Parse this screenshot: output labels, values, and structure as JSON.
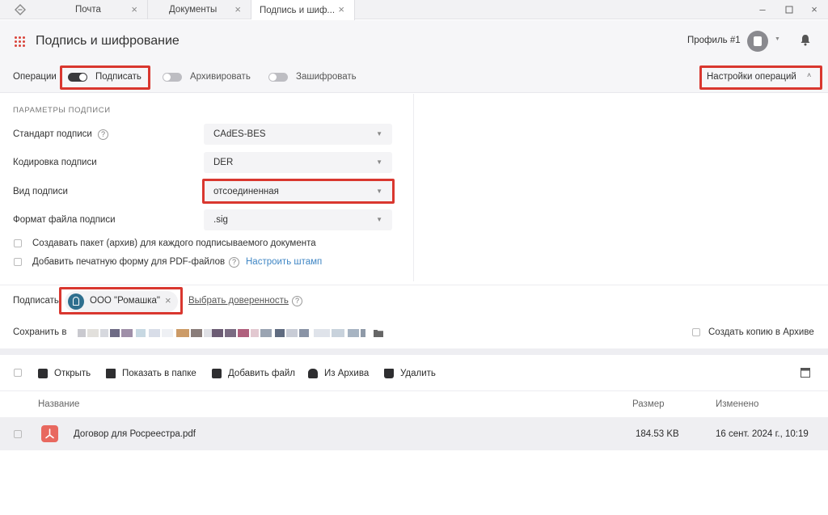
{
  "tabs": [
    {
      "label": "Почта"
    },
    {
      "label": "Документы"
    },
    {
      "label": "Подпись и шиф..."
    }
  ],
  "header": {
    "title": "Подпись и шифрование",
    "profile": "Профиль #1"
  },
  "ops": {
    "label": "Операции",
    "sign": "Подписать",
    "archive": "Архивировать",
    "encrypt": "Зашифровать",
    "settings": "Настройки операций"
  },
  "params": {
    "section_title": "ПАРАМЕТРЫ ПОДПИСИ",
    "standard_label": "Стандарт подписи",
    "standard_value": "CAdES-BES",
    "encoding_label": "Кодировка подписи",
    "encoding_value": "DER",
    "type_label": "Вид подписи",
    "type_value": "отсоединенная",
    "format_label": "Формат файла подписи",
    "format_value": ".sig",
    "pack_checkbox": "Создавать пакет (архив) для каждого подписываемого документа",
    "pdf_checkbox": "Добавить печатную форму для PDF-файлов",
    "stamp_link": "Настроить штамп"
  },
  "signer": {
    "label": "Подписать",
    "chip": "ООО \"Ромашка\"",
    "power_link": "Выбрать доверенность"
  },
  "save": {
    "label": "Сохранить в",
    "copy_checkbox": "Создать копию в Архиве"
  },
  "toolbar": {
    "open": "Открыть",
    "show_folder": "Показать в папке",
    "add_file": "Добавить файл",
    "from_archive": "Из Архива",
    "delete": "Удалить"
  },
  "table": {
    "columns": [
      "Название",
      "Размер",
      "Изменено"
    ],
    "rows": [
      {
        "name": "Договор для Росреестра.pdf",
        "size": "184.53 KB",
        "modified": "16 сент. 2024 г., 10:19"
      }
    ]
  },
  "colors": {
    "accent_red": "#d9372f",
    "link_blue": "#3f86c4",
    "pdf_icon": "#e8685f",
    "chip_avatar": "#2e6f8e"
  }
}
